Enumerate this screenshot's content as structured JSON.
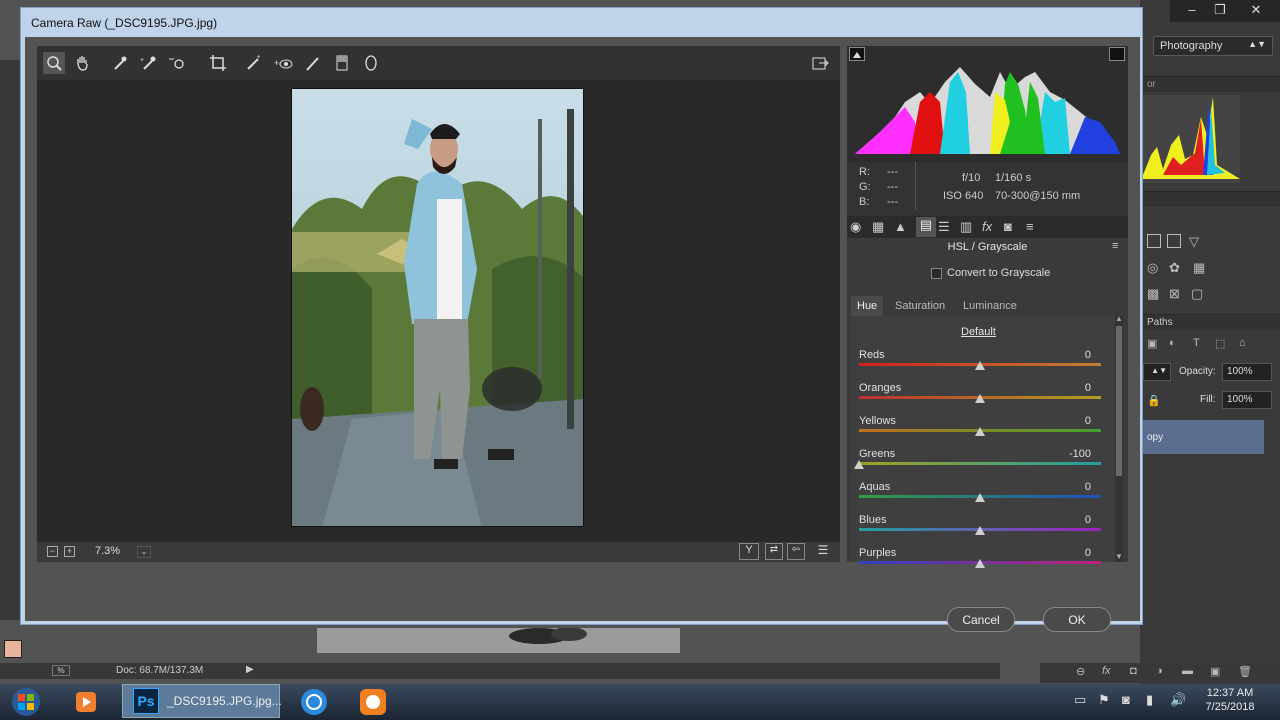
{
  "dialog": {
    "title": "Camera Raw (_DSC9195.JPG.jpg)",
    "zoom": "7.3%",
    "cancel_label": "Cancel",
    "ok_label": "OK"
  },
  "readout": {
    "r_label": "R:",
    "g_label": "G:",
    "b_label": "B:",
    "r_value": "---",
    "g_value": "---",
    "b_value": "---",
    "aperture": "f/10",
    "shutter": "1/160 s",
    "iso": "ISO 640",
    "lens": "70-300@150 mm"
  },
  "hsl": {
    "title": "HSL / Grayscale",
    "grayscale_label": "Convert to Grayscale",
    "tabs": [
      "Hue",
      "Saturation",
      "Luminance"
    ],
    "default_label": "Default",
    "sliders": [
      {
        "label": "Reds",
        "value": "0",
        "colors": [
          "#d02020",
          "#c08030"
        ]
      },
      {
        "label": "Oranges",
        "value": "0",
        "colors": [
          "#c03030",
          "#b0a020"
        ]
      },
      {
        "label": "Yellows",
        "value": "0",
        "colors": [
          "#c07020",
          "#40a030"
        ]
      },
      {
        "label": "Greens",
        "value": "-100",
        "colors": [
          "#a0a020",
          "#20a0a0"
        ]
      },
      {
        "label": "Aquas",
        "value": "0",
        "colors": [
          "#30a040",
          "#2050c0"
        ]
      },
      {
        "label": "Blues",
        "value": "0",
        "colors": [
          "#20a0a0",
          "#a020c0"
        ]
      },
      {
        "label": "Purples",
        "value": "0",
        "colors": [
          "#3040c0",
          "#c02080"
        ]
      }
    ]
  },
  "photoshop": {
    "workspace": "Photography",
    "opacity_label": "Opacity:",
    "opacity_value": "100%",
    "fill_label": "Fill:",
    "fill_value": "100%",
    "paths_tab": "Paths",
    "panel_tab": "or",
    "layer_name": "opy",
    "doc_size": "Doc: 68.7M/137.3M"
  },
  "taskbar": {
    "ps_task_label": "_DSC9195.JPG.jpg...",
    "ps_icon_label": "Ps",
    "time": "12:37 AM",
    "date": "7/25/2018"
  }
}
